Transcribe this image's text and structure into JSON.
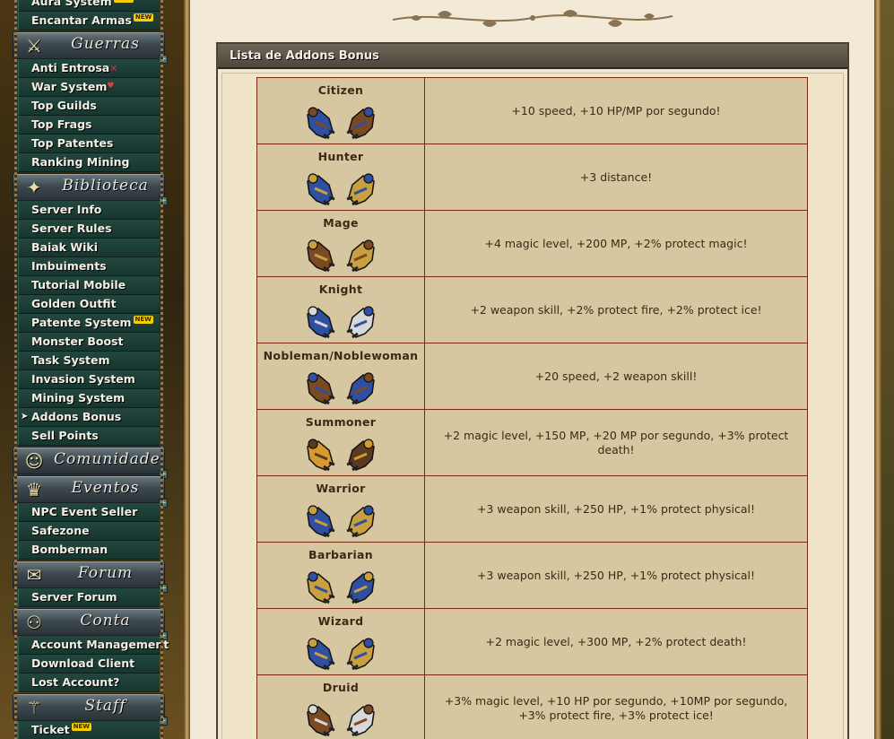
{
  "sidebar": {
    "top_items": [
      {
        "label": "Aura System",
        "new": true
      },
      {
        "label": "Encantar Armas",
        "new": true
      }
    ],
    "sections": [
      {
        "title": "Guerras",
        "icon": "crossed-swords-icon",
        "items": [
          {
            "label": "Anti Entrosa",
            "mark": "x"
          },
          {
            "label": "War System",
            "mark": "shield"
          },
          {
            "label": "Top Guilds"
          },
          {
            "label": "Top Frags"
          },
          {
            "label": "Top Patentes"
          },
          {
            "label": "Ranking Mining"
          }
        ]
      },
      {
        "title": "Biblioteca",
        "icon": "book-icon",
        "items": [
          {
            "label": "Server Info"
          },
          {
            "label": "Server Rules"
          },
          {
            "label": "Baiak Wiki"
          },
          {
            "label": "Imbuiments"
          },
          {
            "label": "Tutorial Mobile"
          },
          {
            "label": "Golden Outfit"
          },
          {
            "label": "Patente System",
            "new": true
          },
          {
            "label": "Monster Boost"
          },
          {
            "label": "Task System"
          },
          {
            "label": "Invasion System"
          },
          {
            "label": "Mining System"
          },
          {
            "label": "Addons Bonus",
            "active": true
          },
          {
            "label": "Sell Points"
          }
        ]
      },
      {
        "title": "Comunidade",
        "icon": "community-icon",
        "items": []
      },
      {
        "title": "Eventos",
        "icon": "event-icon",
        "items": [
          {
            "label": "NPC Event Seller"
          },
          {
            "label": "Safezone"
          },
          {
            "label": "Bomberman"
          }
        ]
      },
      {
        "title": "Forum",
        "icon": "scroll-icon",
        "items": [
          {
            "label": "Server Forum"
          }
        ]
      },
      {
        "title": "Conta",
        "icon": "account-icon",
        "items": [
          {
            "label": "Account Management"
          },
          {
            "label": "Download Client"
          },
          {
            "label": "Lost Account?"
          }
        ]
      },
      {
        "title": "Staff",
        "icon": "staff-icon",
        "items": [
          {
            "label": "Ticket",
            "new": true
          }
        ]
      }
    ],
    "new_badge": "NEW",
    "active_arrow": "➤",
    "plus_sign": "+"
  },
  "panel": {
    "title": "Lista de Addons Bonus"
  },
  "addons": [
    {
      "name": "Citizen",
      "bonus": "+10 speed, +10 HP/MP por segundo!",
      "colors": [
        "#2f4fa0",
        "#7a4a22"
      ]
    },
    {
      "name": "Hunter",
      "bonus": "+3 distance!",
      "colors": [
        "#2f4fa0",
        "#c9a040"
      ]
    },
    {
      "name": "Mage",
      "bonus": "+4 magic level, +200 MP, +2% protect magic!",
      "colors": [
        "#7a4a22",
        "#c9a040"
      ]
    },
    {
      "name": "Knight",
      "bonus": "+2 weapon skill, +2% protect fire, +2% protect ice!",
      "colors": [
        "#2f4fa0",
        "#d8d8d8"
      ]
    },
    {
      "name": "Nobleman/Noblewoman",
      "bonus": "+20 speed, +2 weapon skill!",
      "colors": [
        "#7a4a22",
        "#2f4fa0"
      ]
    },
    {
      "name": "Summoner",
      "bonus": "+2 magic level, +150 MP, +20 MP por segundo, +3% protect death!",
      "colors": [
        "#d79a30",
        "#5a3a20"
      ]
    },
    {
      "name": "Warrior",
      "bonus": "+3 weapon skill, +250 HP, +1% protect physical!",
      "colors": [
        "#2f4fa0",
        "#c9a040"
      ]
    },
    {
      "name": "Barbarian",
      "bonus": "+3 weapon skill, +250 HP, +1% protect physical!",
      "colors": [
        "#c9a040",
        "#2f4fa0"
      ]
    },
    {
      "name": "Wizard",
      "bonus": "+2 magic level, +300 MP, +2% protect death!",
      "colors": [
        "#2f4fa0",
        "#c9a040"
      ]
    },
    {
      "name": "Druid",
      "bonus": "+3% magic level, +10 HP por segundo, +10MP por segundo, +3% protect fire, +3% protect ice!",
      "colors": [
        "#7a4a22",
        "#d8d8d8"
      ]
    }
  ]
}
